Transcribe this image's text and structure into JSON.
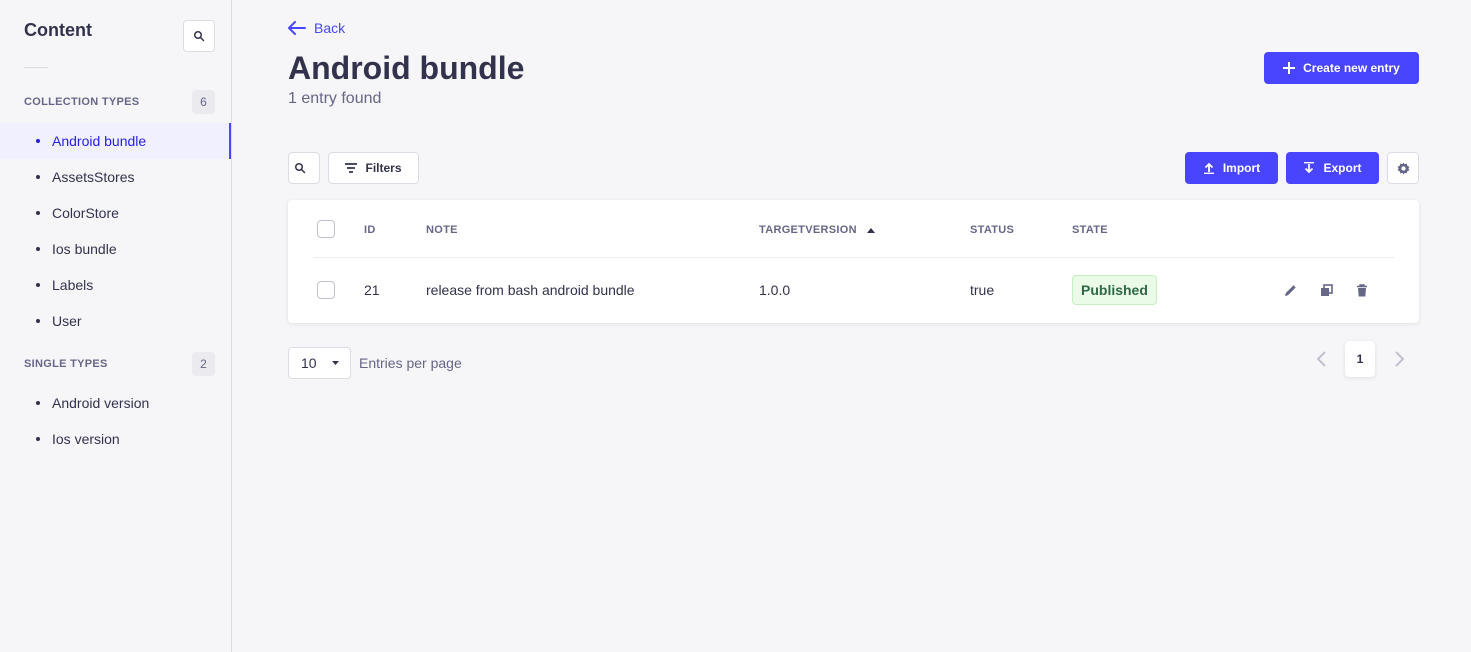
{
  "sidebar": {
    "title": "Content",
    "collection_types": {
      "label": "COLLECTION TYPES",
      "count": "6",
      "items": [
        {
          "label": "Android bundle",
          "active": true
        },
        {
          "label": "AssetsStores"
        },
        {
          "label": "ColorStore"
        },
        {
          "label": "Ios bundle"
        },
        {
          "label": "Labels"
        },
        {
          "label": "User"
        }
      ]
    },
    "single_types": {
      "label": "SINGLE TYPES",
      "count": "2",
      "items": [
        {
          "label": "Android version"
        },
        {
          "label": "Ios version"
        }
      ]
    }
  },
  "header": {
    "back_label": "Back",
    "title": "Android bundle",
    "subtitle": "1 entry found",
    "create_label": "Create new entry"
  },
  "toolbar": {
    "filters_label": "Filters",
    "import_label": "Import",
    "export_label": "Export"
  },
  "table": {
    "columns": [
      "ID",
      "NOTE",
      "TARGETVERSION",
      "STATUS",
      "STATE"
    ],
    "rows": [
      {
        "id": "21",
        "note": "release from bash android bundle",
        "targetversion": "1.0.0",
        "status": "true",
        "state": "Published"
      }
    ]
  },
  "pagination": {
    "per_page": "10",
    "per_page_label": "Entries per page",
    "current_page": "1"
  },
  "colors": {
    "primary": "#4945ff",
    "published_bg": "#eafbe7",
    "published_text": "#2f6846"
  }
}
